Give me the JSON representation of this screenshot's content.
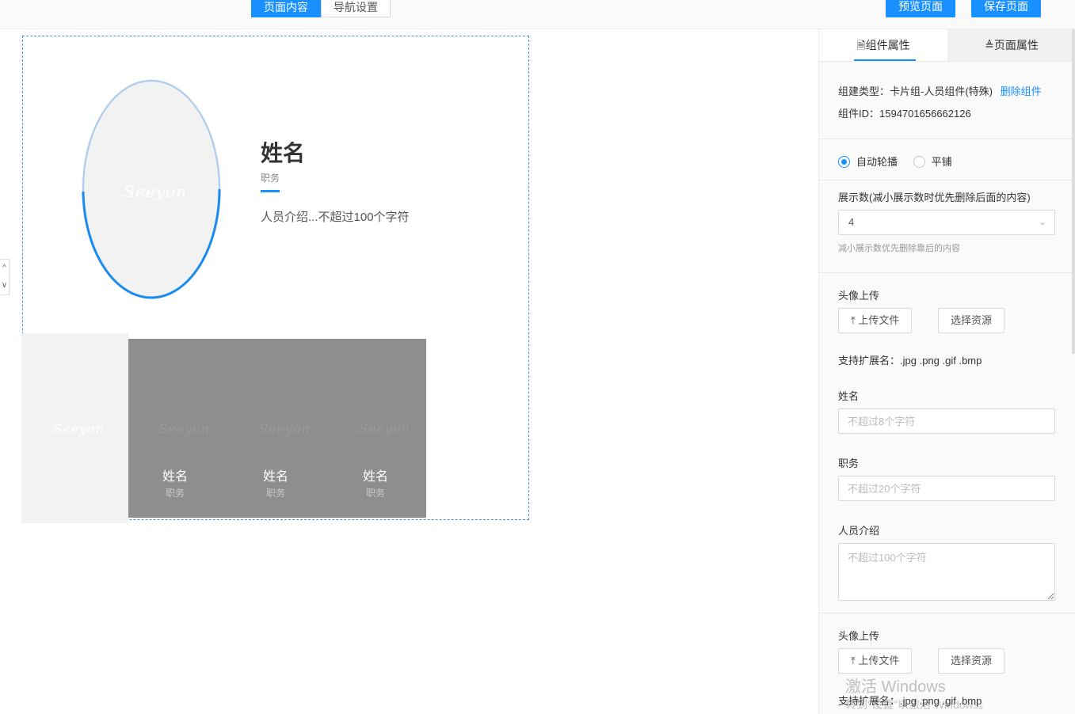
{
  "toolbar": {
    "tab_content": "页面内容",
    "tab_nav": "导航设置",
    "preview": "预览页面",
    "save": "保存页面"
  },
  "canvas": {
    "logo": ".Seeyon",
    "main_name": "姓名",
    "main_post": "职务",
    "main_intro": "人员介绍...不超过100个字符",
    "cards": [
      {
        "name": "姓名",
        "post": "职务"
      },
      {
        "name": "姓名",
        "post": "职务"
      },
      {
        "name": "姓名",
        "post": "职务"
      }
    ]
  },
  "panel": {
    "tab_component": "组件属性",
    "tab_page": "页面属性",
    "type_label": "组建类型：",
    "type_value": "卡片组-人员组件(特殊)",
    "delete": "删除组件",
    "id_label": "组件ID：",
    "id_value": "1594701656662126",
    "radio_auto": "自动轮播",
    "radio_tile": "平铺",
    "count_label": "展示数(减小展示数时优先删除后面的内容)",
    "count_value": "4",
    "count_hint": "减小展示数优先删除靠后的内容",
    "avatar_label": "头像上传",
    "upload": "上传文件",
    "choose": "选择资源",
    "ext_label": "支持扩展名：",
    "ext_value": ".jpg .png .gif .bmp",
    "name_label": "姓名",
    "name_placeholder": "不超过8个字符",
    "post_label": "职务",
    "post_placeholder": "不超过20个字符",
    "intro_label": "人员介绍",
    "intro_placeholder": "不超过100个字符",
    "avatar_label_2": "头像上传",
    "upload_2": "上传文件",
    "choose_2": "选择资源",
    "ext_label_2": "支持扩展名：",
    "ext_value_2": ".jpg .png .gif .bmp"
  },
  "watermark": {
    "line1": "激活 Windows",
    "line2": "转到\"设置\"以激活 Windows。"
  },
  "colors": {
    "accent": "#1890ff",
    "card_dark": "#8e8e8e",
    "card_light": "#f2f2f2"
  }
}
